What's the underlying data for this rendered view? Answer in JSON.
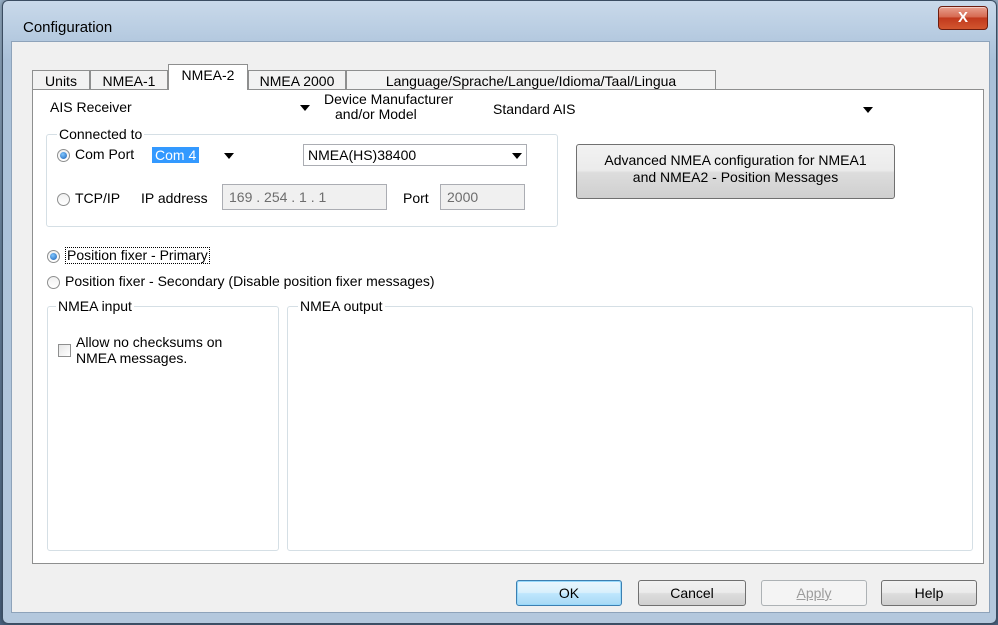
{
  "window": {
    "title": "Configuration",
    "close_glyph": "X"
  },
  "tabs": [
    {
      "label": "Units"
    },
    {
      "label": "NMEA-1"
    },
    {
      "label": "NMEA-2"
    },
    {
      "label": "NMEA 2000"
    },
    {
      "label": "Language/Sprache/Langue/Idioma/Taal/Lingua"
    }
  ],
  "device_type": {
    "value": "AIS Receiver"
  },
  "manufacturer": {
    "label_line1": "Device Manufacturer",
    "label_line2": "and/or Model",
    "value": "Standard AIS"
  },
  "connected_to": {
    "legend": "Connected to",
    "com_port": {
      "label": "Com Port",
      "value": "Com 4",
      "selected": true
    },
    "baud": {
      "value": "NMEA(HS)38400"
    },
    "tcpip": {
      "label": "TCP/IP",
      "selected": false
    },
    "ip_label": "IP address",
    "ip_value": "169 . 254 .  1  .  1",
    "port_label": "Port",
    "port_value": "2000"
  },
  "advanced_button": {
    "line1": "Advanced NMEA configuration for NMEA1",
    "line2": "and NMEA2 - Position Messages"
  },
  "position_fixer": {
    "primary": {
      "label": "Position fixer - Primary",
      "selected": true
    },
    "secondary": {
      "label": "Position fixer - Secondary (Disable position fixer messages)",
      "selected": false
    }
  },
  "nmea_input": {
    "legend": "NMEA input",
    "checkbox_line1": "Allow no checksums on",
    "checkbox_line2": "NMEA messages.",
    "checked": false
  },
  "nmea_output": {
    "legend": "NMEA output"
  },
  "buttons": {
    "ok": "OK",
    "cancel": "Cancel",
    "apply": "Apply",
    "help": "Help"
  },
  "colors": {
    "selection": "#3399ff",
    "close_button": "#c1391d",
    "title_bar": "#b9cde2"
  }
}
